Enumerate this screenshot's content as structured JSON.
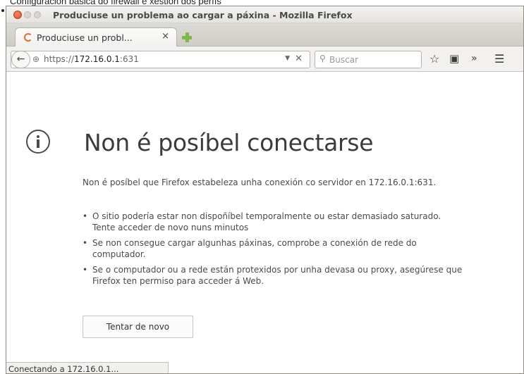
{
  "caption": "Configuración básica do firewall e xestión dos perfís",
  "window": {
    "title": "Produciuse un problema ao cargar a páxina - Mozilla Firefox"
  },
  "tab": {
    "label": "Produciuse un probl...",
    "close": "×"
  },
  "navbar": {
    "back": "←",
    "url_prefix": "https://",
    "url_host": "172.16.0.1",
    "url_suffix": ":631",
    "search_placeholder": "Buscar",
    "icons": [
      "star-icon",
      "reader-icon",
      "overflow-chevron-icon",
      "hamburger-menu-icon"
    ]
  },
  "error": {
    "title": "Non é posíbel conectarse",
    "description": "Non é posíbel que Firefox estabeleza unha conexión co servidor en 172.16.0.1:631.",
    "tips": [
      "O sitio podería estar non dispoñíbel temporalmente ou estar demasiado saturado. Tente acceder de novo nuns minutos",
      "Se non consegue cargar algunhas páxinas, comprobe a conexión de rede do computador.",
      "Se o computador ou a rede están protexidos por unha devasa ou proxy, asegúrese que Firefox ten permiso para acceder á Web."
    ],
    "retry_button": "Tentar de novo"
  },
  "status": "Conectando a 172.16.0.1..."
}
